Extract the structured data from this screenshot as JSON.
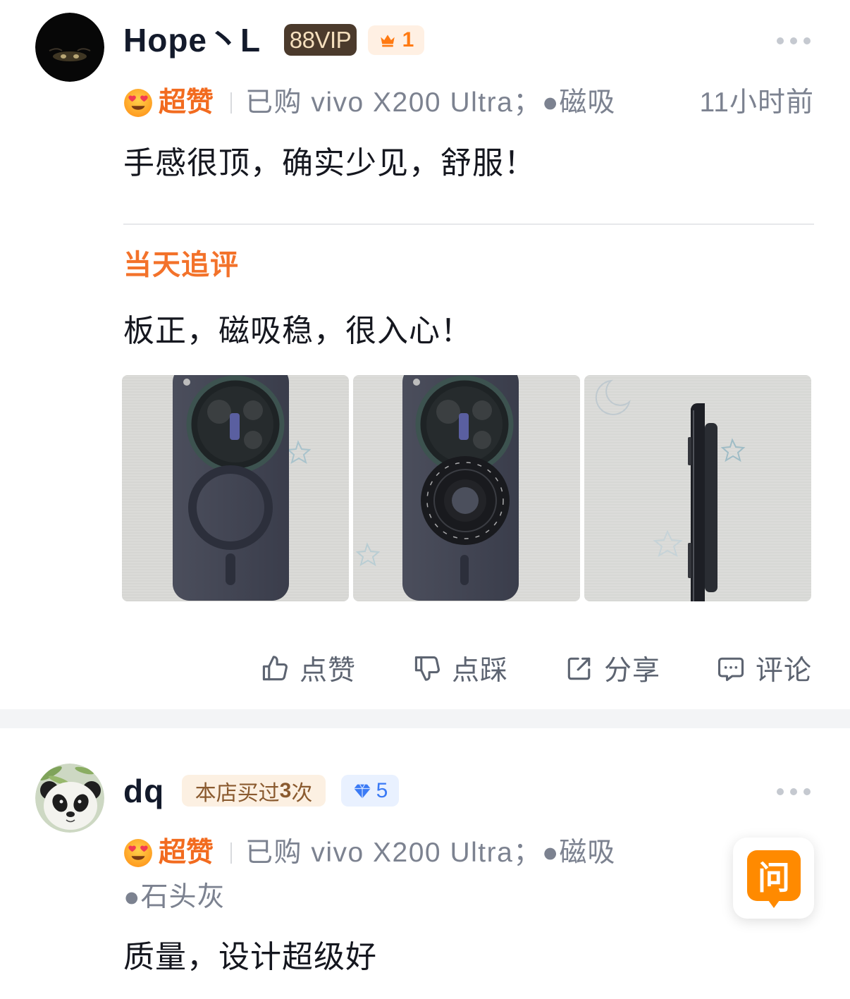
{
  "reviews": [
    {
      "username": "Hope丶L",
      "vip_badge": "88VIP",
      "level_badge": "1",
      "rating_label": "超赞",
      "purchase": "已购 vivo X200 Ultra；",
      "specs": [
        "●磁吸"
      ],
      "time": "11小时前",
      "text": "手感很顶，确实少见，舒服！",
      "follow_up": {
        "label": "当天追评",
        "text": "板正，磁吸稳，很入心！"
      },
      "actions": {
        "like": "点赞",
        "dislike": "点踩",
        "share": "分享",
        "comment": "评论"
      }
    },
    {
      "username": "dq",
      "shop_badge": {
        "prefix": "本店买过",
        "count": "3",
        "suffix": "次"
      },
      "level_badge": "5",
      "rating_label": "超赞",
      "purchase": "已购 vivo X200 Ultra；",
      "specs": [
        "●磁吸",
        "●石头灰"
      ],
      "text": "质量，设计超级好"
    }
  ],
  "floating_button": {
    "label": "问"
  },
  "icons": {
    "rating": "heart-eyes-icon",
    "vip_level": "crown-icon",
    "member_level": "diamond-icon",
    "like": "thumbs-up-icon",
    "dislike": "thumbs-down-icon",
    "share": "share-icon",
    "comment": "comment-icon",
    "more": "more-icon"
  },
  "colors": {
    "accent": "#f26b1f",
    "follow": "#f3722a",
    "text": "#15171f",
    "name": "#131a2b",
    "muted": "#7c8290",
    "divider": "#e7e8eb",
    "band": "#f3f4f6",
    "vip_bg": "#4b3a2c",
    "vip_text": "#f5dfbd",
    "level_bg": "#fff0e3",
    "level_text": "#ff7a12",
    "shop_bg": "#fcf0e2",
    "shop_text": "#8a5a2f",
    "gem_bg": "#e9f1ff",
    "gem_text": "#3a7af5",
    "action": "#5d6471",
    "ask": "#ff8a00"
  }
}
